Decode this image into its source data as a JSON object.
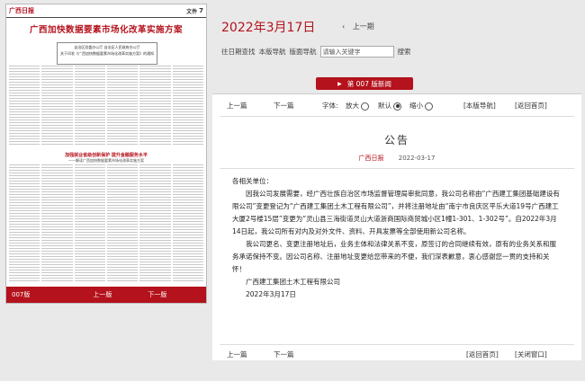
{
  "newspaper": {
    "logo": "广西日报",
    "section": "文件",
    "page_number": "7",
    "headline": "广西加快数据要素市场化改革实施方案",
    "notice_line1": "自治区党委办公厅  自治区人民政府办公厅",
    "notice_line2": "关于印发《广西加快数据要素市场化改革实施方案》的通知",
    "subhead": "加强就业省级创新保护  提升金融服务水平",
    "subhead2": "——解读广西加快数据要素市场化改革实施方案"
  },
  "left_nav": {
    "page_label": "007版",
    "prev": "上一版",
    "next": "下一版"
  },
  "date_title": "2022年3月17日",
  "prev_issue": "上一期",
  "search": {
    "past_issues": "往日期查找",
    "this_nav": "本版导航",
    "layout_nav": "版面导航",
    "placeholder": "请输入关键字",
    "button": "搜索"
  },
  "banner": {
    "label": "第 007 版新闻"
  },
  "toolbar": {
    "prev_article": "上一篇",
    "next_article": "下一篇",
    "font_label": "字体:",
    "enlarge": "放大",
    "default": "默认",
    "shrink": "缩小",
    "this_nav": "[本版导航]",
    "back_home": "[返回首页]"
  },
  "article": {
    "title": "公告",
    "source": "广西日报",
    "date": "2022-03-17",
    "salutation": "各相关单位：",
    "para1": "因我公司发展需要，经广西壮族自治区市场监督管理局审批同意，我公司名称由“广西建工集团基础建设有限公司”变更登记为“广西建工集团土木工程有限公司”，并将注册地址由“南宁市良庆区平乐大道19号广西建工大厦2号楼15层”变更为“灵山县三海街道灵山大道浙商国际商贸城小区1幢1-301、1-302号”。自2022年3月14日起，我公司所有对内及对外文件、资料、开具发票等全部使用新公司名称。",
    "para2": "我公司更名、变更注册地址后，业务主体和法律关系不变，原签订的合同继续有效，原有的业务关系和服务承诺保持不变。因公司名称、注册地址变更给您带来的不便，我们深表歉意，衷心感谢您一贯的支持和关怀！",
    "signature": "广西建工集团土木工程有限公司",
    "sign_date": "2022年3月17日"
  },
  "bottombar": {
    "prev_article": "上一篇",
    "next_article": "下一篇",
    "back_home": "[返回首页]",
    "close": "[关闭窗口]"
  },
  "colors": {
    "accent": "#b4121c",
    "background": "#e9e9e9"
  }
}
